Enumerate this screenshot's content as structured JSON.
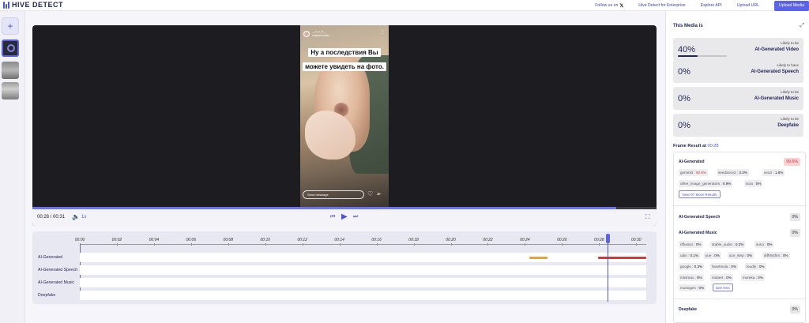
{
  "brand": {
    "name": "HIVE DETECT"
  },
  "nav": {
    "follow": "Follow us on",
    "enterprise": "Hive Detect for Enterprise",
    "explore_api": "Explore API",
    "upload_url": "Upload URL",
    "upload_media": "Upload Media"
  },
  "video": {
    "username": "__x_s_a__",
    "subline": "original audio",
    "caption_line1": "Ну а последствия Вы",
    "caption_line2": "можете увидеть на фото.",
    "send_placeholder": "Send message"
  },
  "player": {
    "time": "00:28 / 00:31",
    "speed": "1x",
    "progress": 0.935
  },
  "timeline": {
    "ticks": [
      "00:00",
      "00:02",
      "00:04",
      "00:06",
      "00:08",
      "00:10",
      "00:12",
      "00:14",
      "00:16",
      "00:18",
      "00:20",
      "00:22",
      "00:24",
      "00:26",
      "00:28",
      "00:30"
    ],
    "tracks": [
      {
        "label": "AI-Generated"
      },
      {
        "label": "AI-Generated Speech"
      },
      {
        "label": "AI-Generated Music"
      },
      {
        "label": "Deepfake"
      }
    ],
    "segments": [
      {
        "track": 0,
        "start_s": 24.2,
        "end_s": 25.2,
        "color": "#e8a040"
      },
      {
        "track": 0,
        "start_s": 27.9,
        "end_s": 30.5,
        "color": "#d03a3a"
      }
    ],
    "duration_s": 30.5,
    "playhead_s": 28.4
  },
  "panel": {
    "title": "This Media is",
    "cards": [
      {
        "pct": "40%",
        "likely": "Likely to be",
        "cls": "AI-Generated Video",
        "bar": 0.4
      },
      {
        "pct": "0%",
        "likely": "Likely to have",
        "cls": "AI-Generated Speech"
      },
      {
        "pct": "0%",
        "likely": "Likely to be",
        "cls": "AI-Generated Music"
      },
      {
        "pct": "0%",
        "likely": "Likely to be",
        "cls": "Deepfake"
      }
    ],
    "frame_result_label": "Frame Result at",
    "frame_result_time": "00:28",
    "ai_generated": {
      "title": "AI-Generated",
      "score": "99.6%",
      "models": [
        {
          "name": "gemini3",
          "val": "92.9%"
        },
        {
          "name": "seedance2",
          "val": "3.3%"
        },
        {
          "name": "veo3",
          "val": "1.8%"
        },
        {
          "name": "other_image_generators",
          "val": "0.9%"
        },
        {
          "name": "sora",
          "val": "0%"
        }
      ],
      "more_btn": "View 97 More Results"
    },
    "speech": {
      "title": "AI-Generated Speech",
      "score": "0%"
    },
    "music": {
      "title": "AI-Generated Music",
      "score": "0%",
      "models": [
        {
          "name": "riffusion",
          "val": "0%"
        },
        {
          "name": "stable_audio",
          "val": "0.2%"
        },
        {
          "name": "suno",
          "val": "0%"
        },
        {
          "name": "udio",
          "val": "0.1%"
        },
        {
          "name": "yue",
          "val": "0%"
        },
        {
          "name": "ace_step",
          "val": "0%"
        },
        {
          "name": "diffrhythm",
          "val": "0%"
        },
        {
          "name": "google",
          "val": "0.3%"
        },
        {
          "name": "heartmula",
          "val": "0%"
        },
        {
          "name": "loudly",
          "val": "0%"
        },
        {
          "name": "minimax",
          "val": "0%"
        },
        {
          "name": "mubert",
          "val": "0%"
        },
        {
          "name": "mureka",
          "val": "0%"
        },
        {
          "name": "musicgen",
          "val": "0%"
        }
      ],
      "less_btn": "See less"
    },
    "deepfake": {
      "title": "Deepfake",
      "score": "0%"
    }
  }
}
